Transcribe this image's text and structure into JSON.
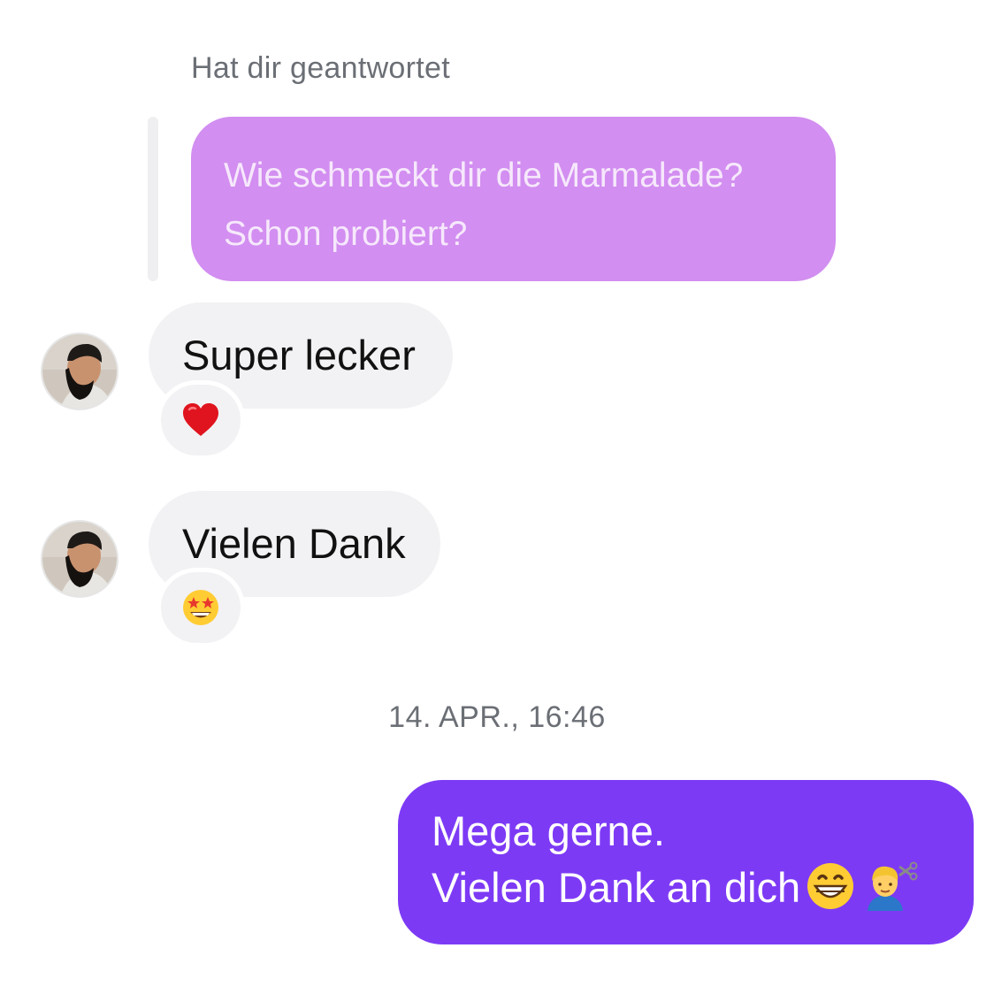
{
  "reply_context": {
    "label": "Hat dir geantwortet",
    "quoted_lines": [
      "Wie schmeckt dir die Marmalade?",
      "Schon probiert?"
    ]
  },
  "messages": [
    {
      "text": "Super lecker",
      "reaction": "heart"
    },
    {
      "text": "Vielen Dank",
      "reaction": "star-struck"
    }
  ],
  "timestamp": "14. APR., 16:46",
  "outgoing": {
    "line1": "Mega gerne.",
    "line2": "Vielen Dank an dich",
    "emojis": [
      "grinning-face",
      "person-getting-haircut"
    ]
  },
  "colors": {
    "quoted_bubble": "#d28ef0",
    "outgoing_bubble": "#7d3af5",
    "incoming_bubble": "#f2f2f4"
  }
}
